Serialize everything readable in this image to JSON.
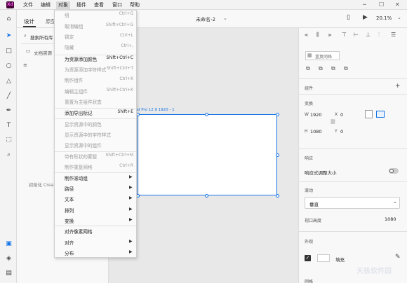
{
  "app": {
    "logo": "Xd",
    "doc_title": "未命名-2",
    "zoom": "20.1%"
  },
  "menubar": [
    "文件",
    "编辑",
    "对象",
    "插件",
    "查看",
    "窗口",
    "帮助"
  ],
  "left_panel": {
    "tabs": [
      "设计",
      "原型"
    ],
    "search_placeholder": "搜索所有库",
    "doc_assets": "文档资源",
    "init_text": "初始化 Creat"
  },
  "artboard_label": "iPad Pro 12.9 1920 - 1",
  "object_menu": [
    {
      "label": "组",
      "shortcut": "Ctrl+G",
      "enabled": false
    },
    {
      "label": "取消编组",
      "shortcut": "Shift+Ctrl+G",
      "enabled": false
    },
    {
      "label": "锁定",
      "shortcut": "Ctrl+L",
      "enabled": false
    },
    {
      "label": "隐藏",
      "shortcut": "Ctrl+,",
      "enabled": false
    },
    {
      "label": "为资源添加颜色",
      "shortcut": "Shift+Ctrl+C",
      "enabled": true
    },
    {
      "label": "为资源添加字符样式",
      "shortcut": "Shift+Ctrl+T",
      "enabled": false
    },
    {
      "label": "制作组件",
      "shortcut": "Ctrl+K",
      "enabled": false
    },
    {
      "label": "编辑主组件",
      "shortcut": "Shift+Ctrl+K",
      "enabled": false
    },
    {
      "label": "重置为主组件状态",
      "shortcut": "",
      "enabled": false
    },
    {
      "label": "添加导出标记",
      "shortcut": "Shift+E",
      "enabled": true
    },
    {
      "label": "显示资源中的颜色",
      "shortcut": "",
      "enabled": false
    },
    {
      "label": "显示资源中的字符样式",
      "shortcut": "",
      "enabled": false
    },
    {
      "label": "显示资源中的组件",
      "shortcut": "",
      "enabled": false
    },
    {
      "label": "带有形状的蒙版",
      "shortcut": "Shift+Ctrl+M",
      "enabled": false
    },
    {
      "label": "制作重复网格",
      "shortcut": "Ctrl+R",
      "enabled": false
    },
    {
      "label": "制作滚动组",
      "shortcut": "",
      "enabled": true,
      "submenu": true
    },
    {
      "label": "路径",
      "shortcut": "",
      "enabled": true,
      "submenu": true
    },
    {
      "label": "文本",
      "shortcut": "",
      "enabled": true,
      "submenu": true
    },
    {
      "label": "排列",
      "shortcut": "",
      "enabled": true,
      "submenu": true
    },
    {
      "label": "变换",
      "shortcut": "",
      "enabled": true,
      "submenu": true
    },
    {
      "label": "对齐像素网格",
      "shortcut": "",
      "enabled": true
    },
    {
      "label": "对齐",
      "shortcut": "",
      "enabled": true,
      "submenu": true
    },
    {
      "label": "分布",
      "shortcut": "",
      "enabled": true,
      "submenu": true
    }
  ],
  "right_panel": {
    "repeat_grid": "重复网格",
    "component": "组件",
    "transform": "变换",
    "w_label": "W",
    "w_value": "1920",
    "h_label": "H",
    "h_value": "1080",
    "x_label": "X",
    "x_value": "0",
    "y_label": "Y",
    "y_value": "0",
    "responsive_section": "响应",
    "responsive_resize": "响应式调整大小",
    "scroll_section": "滚动",
    "scroll_value": "垂直",
    "viewport_label": "视口高度",
    "viewport_value": "1080",
    "appearance": "外观",
    "fill": "填充",
    "bottom_label": "网格"
  },
  "watermark": "天极软件园"
}
